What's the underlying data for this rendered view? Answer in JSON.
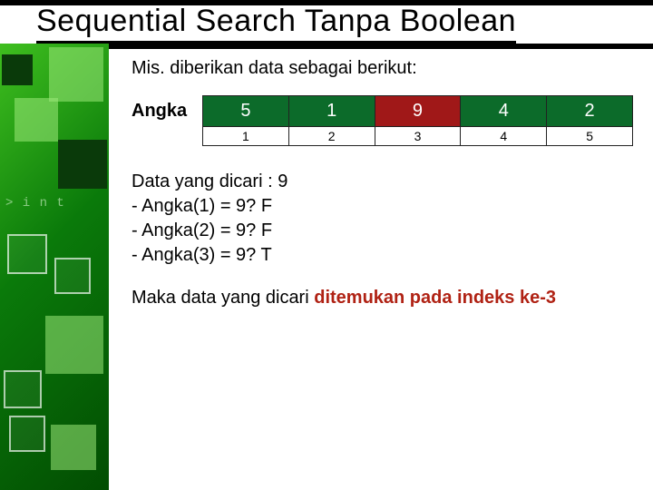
{
  "title": "Sequential Search Tanpa Boolean",
  "lead": "Mis. diberikan data sebagai berikut:",
  "array_label": "Angka",
  "array": {
    "values": [
      5,
      1,
      9,
      4,
      2
    ],
    "indices": [
      1,
      2,
      3,
      4,
      5
    ],
    "highlight_index": 2
  },
  "steps": {
    "intro": "Data yang dicari : 9",
    "lines": [
      "- Angka(1) = 9? F",
      "- Angka(2) = 9? F",
      "- Angka(3) = 9? T"
    ]
  },
  "conclusion_prefix": "Maka data yang dicari ",
  "conclusion_emph": "ditemukan pada indeks ke-3",
  "chart_data": {
    "type": "table",
    "title": "Array Angka",
    "categories": [
      1,
      2,
      3,
      4,
      5
    ],
    "values": [
      5,
      1,
      9,
      4,
      2
    ],
    "search_target": 9,
    "found_at_index": 3
  }
}
